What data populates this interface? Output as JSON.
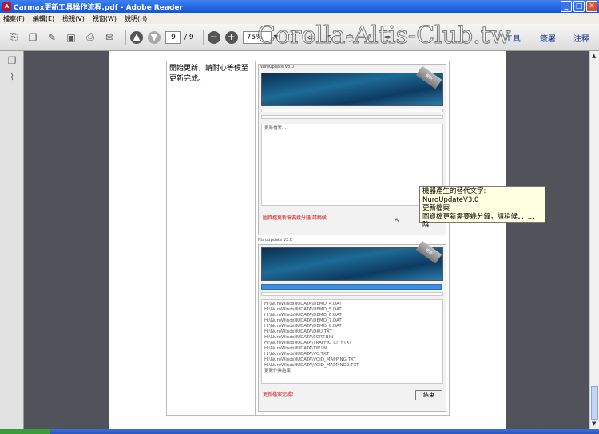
{
  "window": {
    "title": "Carmax更新工具操作流程.pdf - Adobe Reader",
    "app_icon": "adobe-reader-icon",
    "controls": [
      "_",
      "□",
      "✕"
    ]
  },
  "menu": [
    "檔案(F)",
    "編輯(E)",
    "檢視(V)",
    "視窗(W)",
    "說明(H)"
  ],
  "toolbar": {
    "current_page": "9",
    "total_pages": "/ 9",
    "zoom": "75%",
    "tools_label": "工具",
    "sign_label": "簽署",
    "comment_label": "注釋"
  },
  "watermark": "Corolla-Altis-Club.tw",
  "document": {
    "step_text": "開始更新，請耐心等候至更新完成。",
    "shot1": {
      "title": "NuroUpdate V3.0",
      "status": "更新檔案...",
      "red_message": "圖資檔更新需要幾分鐘,請稍候....",
      "badge": "更新"
    },
    "shot2": {
      "title": "NuroUpdate V3.0",
      "badge": "更新",
      "log_lines": [
        "H:\\NuroWinds\\IUDATA\\DEMO_4.DAT",
        "H:\\NuroWinds\\IUDATA\\DEMO_5.DAT",
        "H:\\NuroWinds\\IUDATA\\DEMO_6.DAT",
        "H:\\NuroWinds\\IUDATA\\DEMO_7.DAT",
        "H:\\NuroWinds\\IUDATA\\DEMO_8.DAT",
        "H:\\NuroWinds\\IUDATA\\DKU.TXT",
        "H:\\NuroWinds\\IUDATA\\SORT.BIN",
        "H:\\NuroWinds\\IUDATA\\TRAFFIC_CITY.TXT",
        "H:\\NuroWinds\\IUDATA\\TW.LN",
        "H:\\NuroWinds\\IUDATA\\VO.TXT",
        "H:\\NuroWinds\\IUDATA\\VOID_MAPPING.TXT",
        "H:\\NuroWinds\\IUDATA\\VOID_MAPPING2.TXT",
        "更新作業結束！"
      ],
      "red_message": "更新檔案完成！",
      "end_button": "結束"
    },
    "tooltip_lines": [
      "機器產生的替代文字: NuroUpdateV3.0",
      "更新檔案",
      "圖資檔更新需要幾分鐘，請稍候．．...",
      "陰"
    ]
  }
}
